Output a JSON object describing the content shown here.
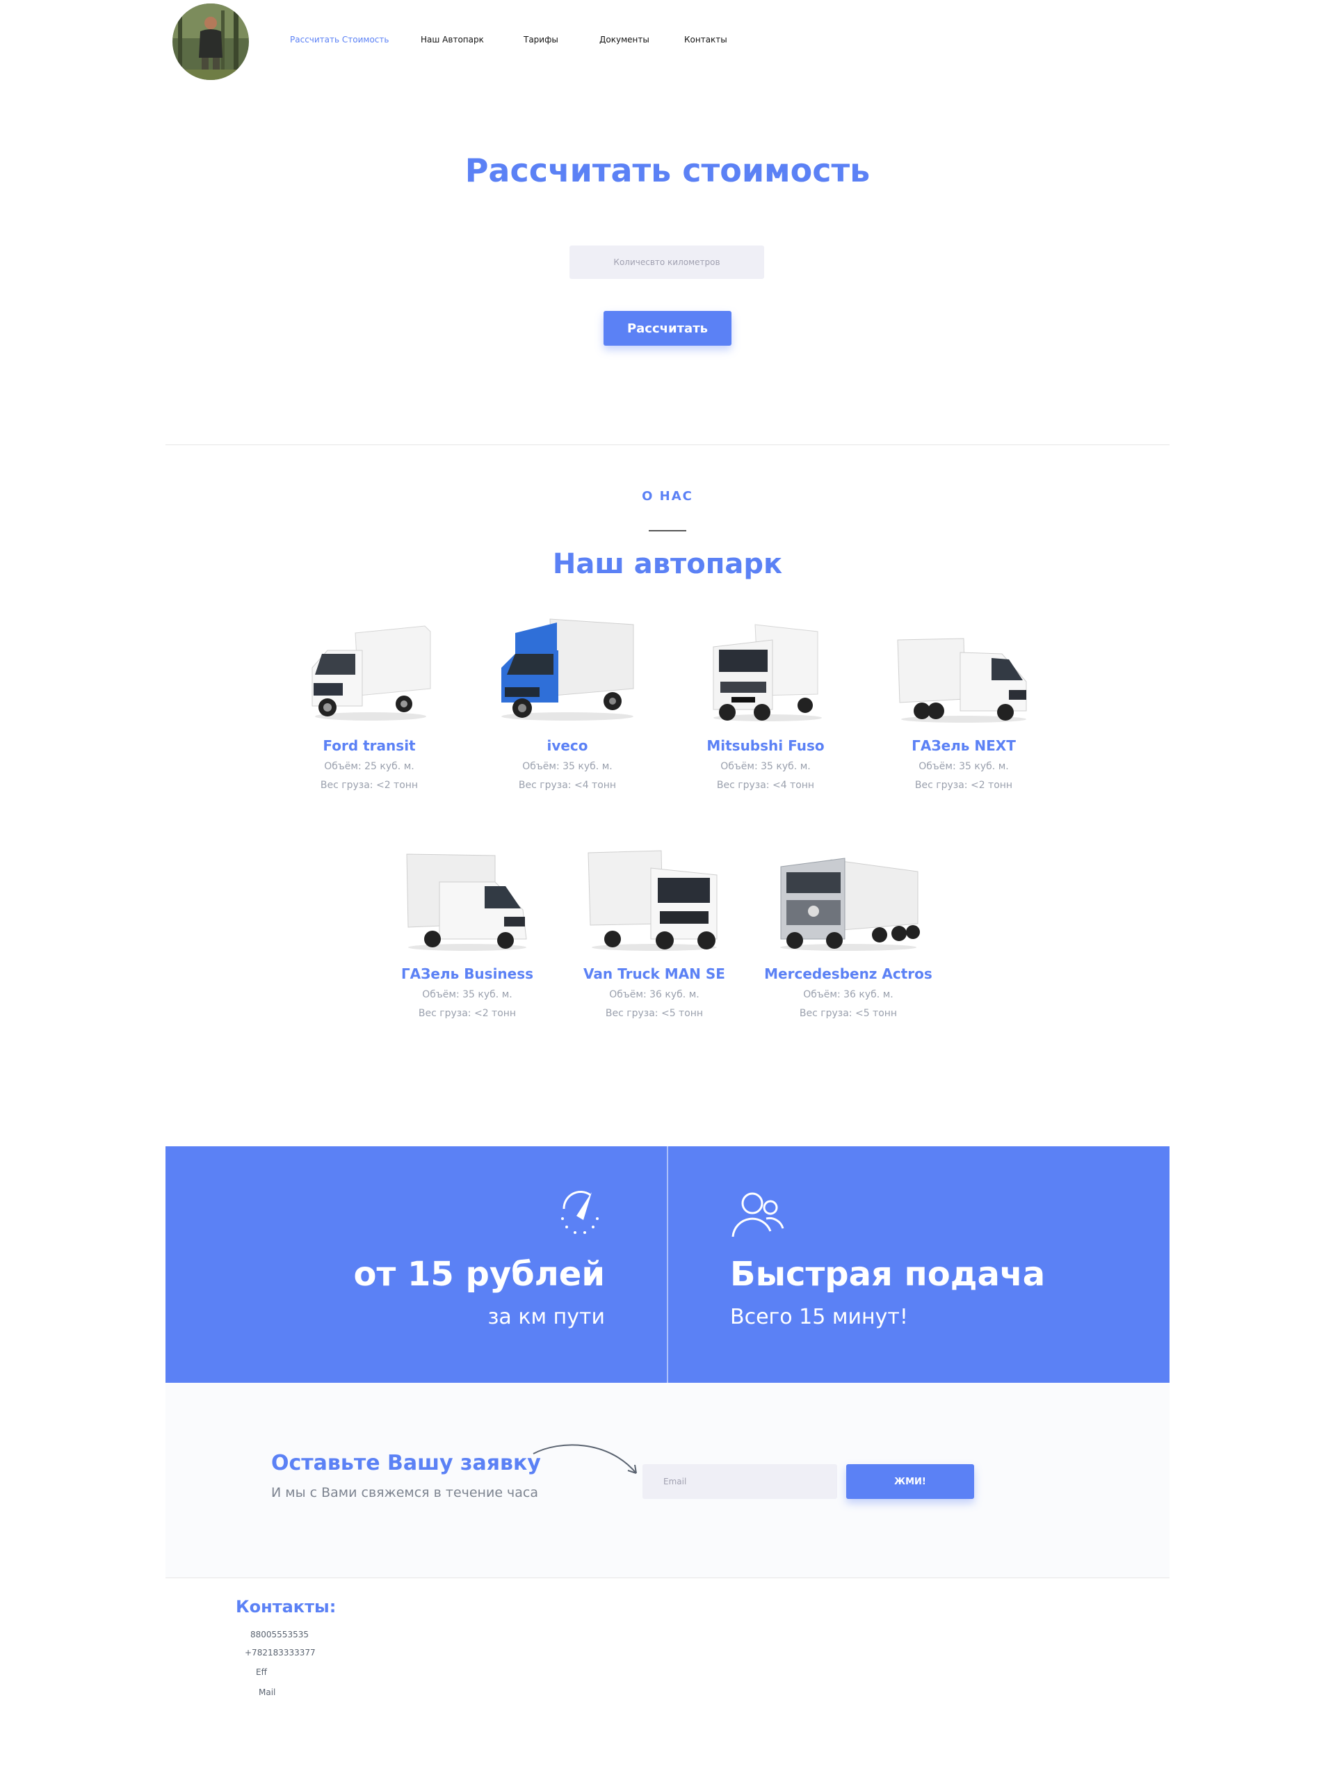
{
  "nav": {
    "items": [
      {
        "label": "Рассчитать Стоимость",
        "active": true
      },
      {
        "label": "Наш Автопарк",
        "active": false
      },
      {
        "label": "Тарифы",
        "active": false
      },
      {
        "label": "Документы",
        "active": false
      },
      {
        "label": "Контакты",
        "active": false
      }
    ]
  },
  "calc": {
    "title": "Рассчитать стоимость",
    "input_placeholder": "Количесвто километров",
    "button_label": "Рассчитать"
  },
  "about": {
    "kicker": "О НАС",
    "title": "Наш автопарк"
  },
  "fleet": [
    {
      "name": "Ford transit",
      "volume": "Объём: 25 куб. м.",
      "weight": "Вес груза: <2 тонн",
      "color": "#ffffff",
      "icon": "van-icon"
    },
    {
      "name": "iveco",
      "volume": "Объём: 35 куб. м.",
      "weight": "Вес груза: <4 тонн",
      "color": "#2f6fd8",
      "icon": "truck-icon"
    },
    {
      "name": "Mitsubshi Fuso",
      "volume": "Объём: 35 куб. м.",
      "weight": "Вес груза: <4 тонн",
      "color": "#ffffff",
      "icon": "truck-icon"
    },
    {
      "name": "ГАЗель NEXT",
      "volume": "Объём: 35 куб. м.",
      "weight": "Вес груза: <2 тонн",
      "color": "#ffffff",
      "icon": "truck-icon"
    },
    {
      "name": "ГАЗель Business",
      "volume": "Объём: 35 куб. м.",
      "weight": "Вес груза: <2 тонн",
      "color": "#ffffff",
      "icon": "truck-icon"
    },
    {
      "name": "Van Truck MAN SE",
      "volume": "Объём: 36 куб. м.",
      "weight": "Вес груза: <5 тонн",
      "color": "#ffffff",
      "icon": "truck-icon"
    },
    {
      "name": "Mercedesbenz Actros",
      "volume": "Объём: 36 куб. м.",
      "weight": "Вес груза: <5 тонн",
      "color": "#c9ccd1",
      "icon": "semi-truck-icon"
    }
  ],
  "features": {
    "left": {
      "title": "от 15 рублей",
      "subtitle": "за км пути",
      "icon": "speedometer-icon"
    },
    "right": {
      "title": "Быстрая подача",
      "subtitle": "Всего 15 минут!",
      "icon": "users-icon"
    }
  },
  "lead": {
    "title": "Оставьте Вашу заявку",
    "subtitle": "И мы с Вами свяжемся в течение часа",
    "email_placeholder": "Email",
    "button_label": "ЖМИ!"
  },
  "contacts": {
    "title": "Контакты:",
    "phone1": "88005553535",
    "phone2": "+782183333377",
    "line3": "Eff",
    "line4": "Mail"
  },
  "colors": {
    "accent": "#5b81f5",
    "input_bg": "#efeff6"
  }
}
